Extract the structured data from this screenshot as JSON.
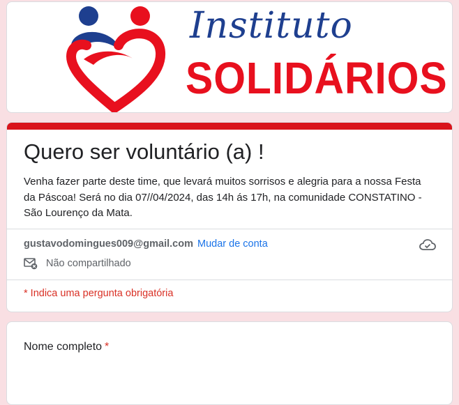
{
  "banner": {
    "brand_script": "Instituto",
    "brand_main": "SOLIDÁRIOS",
    "colors": {
      "blue": "#1e3f8f",
      "red": "#e8101e"
    }
  },
  "form": {
    "title": "Quero ser voluntário (a) !",
    "description": "Venha fazer parte deste time, que levará muitos sorrisos e alegria para a nossa Festa da Páscoa! Será no dia 07//04/2024, das 14h ás 17h, na comunidade CONSTATINO - São Lourenço da Mata.",
    "accent_color": "#d9141c"
  },
  "account": {
    "email": "gustavodomingues009@gmail.com",
    "switch_label": "Mudar de conta",
    "shared_status": "Não compartilhado",
    "icons": {
      "sync": "cloud-sync-icon",
      "shared": "mail-not-shared-icon"
    }
  },
  "required_note": "* Indica uma pergunta obrigatória",
  "questions": [
    {
      "label": "Nome completo",
      "required_mark": "*"
    }
  ]
}
